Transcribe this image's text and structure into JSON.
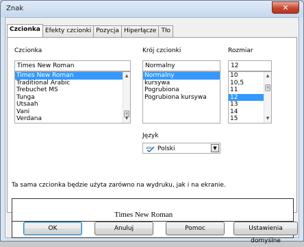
{
  "window": {
    "title": "Znak",
    "close_glyph": "✕"
  },
  "tabs": [
    {
      "label": "Czcionka",
      "active": true
    },
    {
      "label": "Efekty czcionki",
      "active": false
    },
    {
      "label": "Pozycja",
      "active": false
    },
    {
      "label": "Hiperłącze",
      "active": false
    },
    {
      "label": "Tło",
      "active": false
    }
  ],
  "font": {
    "label": "Czcionka",
    "value": "Times New Roman",
    "items": [
      "Times New Roman",
      "Traditional Arabic",
      "Trebuchet MS",
      "Tunga",
      "Utsaah",
      "Vani",
      "Verdana"
    ],
    "selected": "Times New Roman"
  },
  "style": {
    "label": "Krój czcionki",
    "value": "Normalny",
    "items": [
      "Normalny",
      "kursywa",
      "Pogrubiona",
      "Pogrubiona kursywa"
    ],
    "selected": "Normalny"
  },
  "size": {
    "label": "Rozmiar",
    "value": "12",
    "items": [
      "10",
      "10,5",
      "11",
      "12",
      "13",
      "14",
      "15"
    ],
    "selected": "12"
  },
  "language": {
    "label": "Język",
    "value": "Polski",
    "icon": "abc-check-icon"
  },
  "info_text": "Ta sama czcionka będzie użyta zarówno na wydruku, jak i na ekranie.",
  "preview_text": "Times New Roman",
  "buttons": {
    "ok": "OK",
    "cancel": "Anuluj",
    "help": "Pomoc",
    "defaults": "Ustawienia domyślne"
  }
}
